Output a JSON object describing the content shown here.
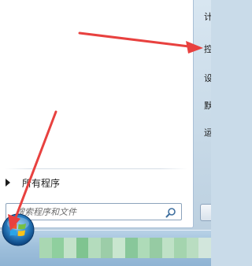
{
  "start_menu": {
    "all_programs_label": "所有程序",
    "search_placeholder": "搜索程序和文件",
    "right_items": [
      {
        "label": "计"
      },
      {
        "label": "控"
      },
      {
        "label": "设"
      },
      {
        "label": "默"
      },
      {
        "label": "运"
      }
    ]
  },
  "taskbar": {
    "blurred_items": [
      {
        "color": "#a9d7b2"
      },
      {
        "color": "#8fcf9e"
      },
      {
        "color": "#c3e2c9"
      },
      {
        "color": "#7fc490"
      },
      {
        "color": "#b4dcbd"
      },
      {
        "color": "#9ccda8"
      },
      {
        "color": "#c9e6cf"
      },
      {
        "color": "#88c79a"
      },
      {
        "color": "#aedbb8"
      },
      {
        "color": "#96cba3"
      },
      {
        "color": "#bfe1c6"
      },
      {
        "color": "#a4d4ae"
      },
      {
        "color": "#b9ddc1"
      },
      {
        "color": "#d2e6dc"
      }
    ]
  },
  "annotations": {
    "arrow_color": "#e8413f"
  }
}
